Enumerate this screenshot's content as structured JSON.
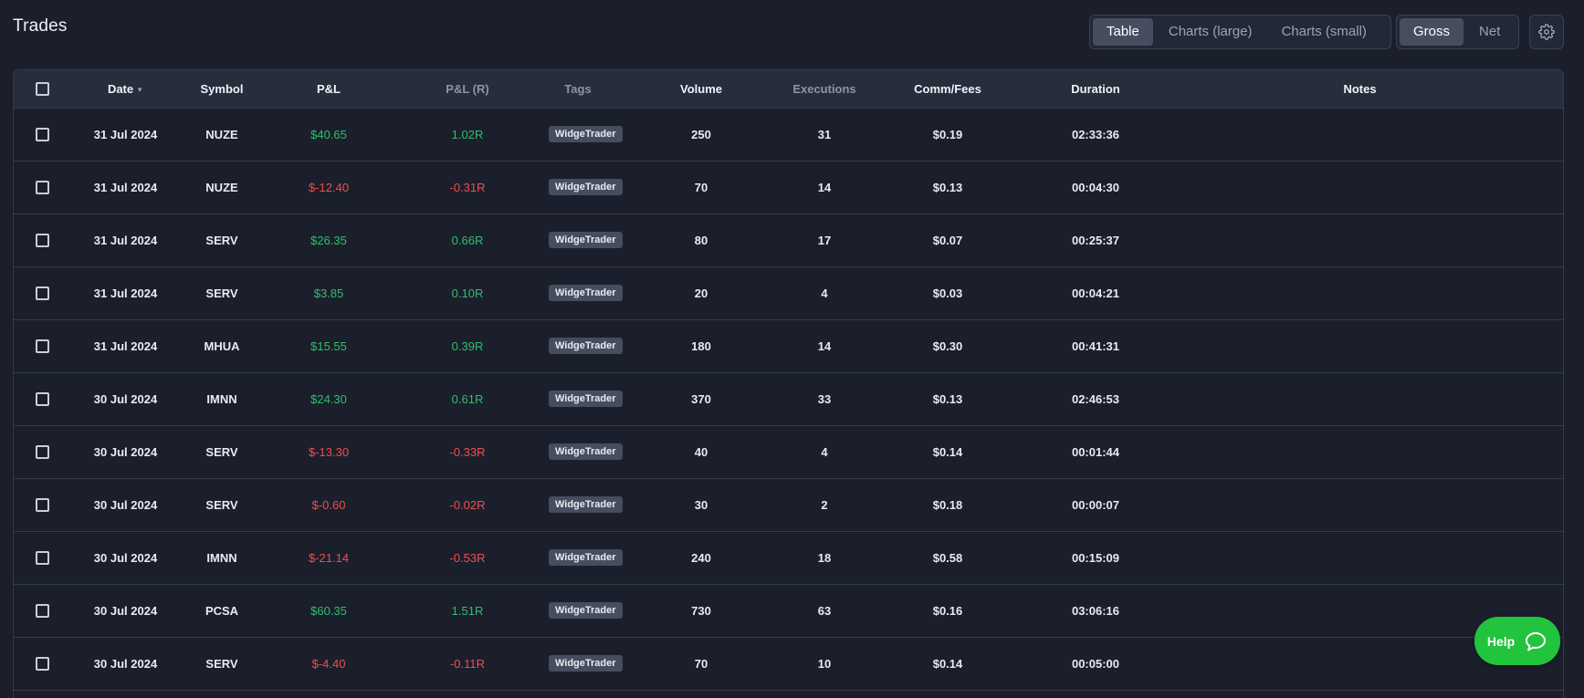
{
  "page": {
    "title": "Trades"
  },
  "view_toggle": {
    "table": "Table",
    "charts_large": "Charts (large)",
    "charts_small": "Charts (small)",
    "active": "Table"
  },
  "pnl_toggle": {
    "gross": "Gross",
    "net": "Net",
    "active": "Gross"
  },
  "icons": {
    "settings": "gear-icon",
    "help": "chat-bubble-icon",
    "sort": "caret-down-icon"
  },
  "colors": {
    "positive": "#2fbf6b",
    "negative": "#f04e4e",
    "help_button": "#22c33d"
  },
  "table": {
    "columns": {
      "date": "Date",
      "symbol": "Symbol",
      "pnl": "P&L",
      "pnl_r": "P&L (R)",
      "tags": "Tags",
      "volume": "Volume",
      "executions": "Executions",
      "comm_fees": "Comm/Fees",
      "duration": "Duration",
      "notes": "Notes"
    },
    "rows": [
      {
        "date": "31 Jul 2024",
        "symbol": "NUZE",
        "pnl": "$40.65",
        "pnl_r": "1.02R",
        "tag": "WidgeTrader",
        "volume": "250",
        "executions": "31",
        "fees": "$0.19",
        "duration": "02:33:36",
        "notes": "",
        "sign": "pos"
      },
      {
        "date": "31 Jul 2024",
        "symbol": "NUZE",
        "pnl": "$-12.40",
        "pnl_r": "-0.31R",
        "tag": "WidgeTrader",
        "volume": "70",
        "executions": "14",
        "fees": "$0.13",
        "duration": "00:04:30",
        "notes": "",
        "sign": "neg"
      },
      {
        "date": "31 Jul 2024",
        "symbol": "SERV",
        "pnl": "$26.35",
        "pnl_r": "0.66R",
        "tag": "WidgeTrader",
        "volume": "80",
        "executions": "17",
        "fees": "$0.07",
        "duration": "00:25:37",
        "notes": "",
        "sign": "pos"
      },
      {
        "date": "31 Jul 2024",
        "symbol": "SERV",
        "pnl": "$3.85",
        "pnl_r": "0.10R",
        "tag": "WidgeTrader",
        "volume": "20",
        "executions": "4",
        "fees": "$0.03",
        "duration": "00:04:21",
        "notes": "",
        "sign": "pos"
      },
      {
        "date": "31 Jul 2024",
        "symbol": "MHUA",
        "pnl": "$15.55",
        "pnl_r": "0.39R",
        "tag": "WidgeTrader",
        "volume": "180",
        "executions": "14",
        "fees": "$0.30",
        "duration": "00:41:31",
        "notes": "",
        "sign": "pos"
      },
      {
        "date": "30 Jul 2024",
        "symbol": "IMNN",
        "pnl": "$24.30",
        "pnl_r": "0.61R",
        "tag": "WidgeTrader",
        "volume": "370",
        "executions": "33",
        "fees": "$0.13",
        "duration": "02:46:53",
        "notes": "",
        "sign": "pos"
      },
      {
        "date": "30 Jul 2024",
        "symbol": "SERV",
        "pnl": "$-13.30",
        "pnl_r": "-0.33R",
        "tag": "WidgeTrader",
        "volume": "40",
        "executions": "4",
        "fees": "$0.14",
        "duration": "00:01:44",
        "notes": "",
        "sign": "neg"
      },
      {
        "date": "30 Jul 2024",
        "symbol": "SERV",
        "pnl": "$-0.60",
        "pnl_r": "-0.02R",
        "tag": "WidgeTrader",
        "volume": "30",
        "executions": "2",
        "fees": "$0.18",
        "duration": "00:00:07",
        "notes": "",
        "sign": "neg"
      },
      {
        "date": "30 Jul 2024",
        "symbol": "IMNN",
        "pnl": "$-21.14",
        "pnl_r": "-0.53R",
        "tag": "WidgeTrader",
        "volume": "240",
        "executions": "18",
        "fees": "$0.58",
        "duration": "00:15:09",
        "notes": "",
        "sign": "neg"
      },
      {
        "date": "30 Jul 2024",
        "symbol": "PCSA",
        "pnl": "$60.35",
        "pnl_r": "1.51R",
        "tag": "WidgeTrader",
        "volume": "730",
        "executions": "63",
        "fees": "$0.16",
        "duration": "03:06:16",
        "notes": "",
        "sign": "pos"
      },
      {
        "date": "30 Jul 2024",
        "symbol": "SERV",
        "pnl": "$-4.40",
        "pnl_r": "-0.11R",
        "tag": "WidgeTrader",
        "volume": "70",
        "executions": "10",
        "fees": "$0.14",
        "duration": "00:05:00",
        "notes": "",
        "sign": "neg"
      }
    ]
  },
  "help": {
    "label": "Help"
  }
}
